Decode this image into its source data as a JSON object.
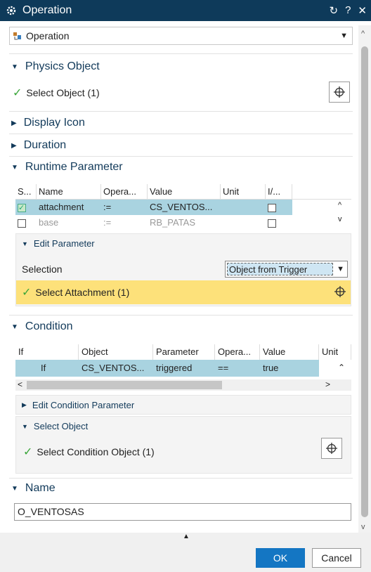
{
  "window": {
    "title": "Operation",
    "controls": [
      "↻",
      "?",
      "✕"
    ]
  },
  "type_dropdown": {
    "value": "Operation"
  },
  "physics_object": {
    "heading": "Physics Object",
    "select_label": "Select Object (1)"
  },
  "display_icon": {
    "heading": "Display Icon"
  },
  "duration": {
    "heading": "Duration"
  },
  "runtime_parameter": {
    "heading": "Runtime Parameter",
    "columns": [
      "S...",
      "Name",
      "Opera...",
      "Value",
      "Unit",
      "I/..."
    ],
    "rows": [
      {
        "name": "attachment",
        "op": ":=",
        "value": "CS_VENTOS...",
        "unit": "",
        "checked": true,
        "selected": true
      },
      {
        "name": "base",
        "op": ":=",
        "value": "RB_PATAS",
        "unit": "",
        "checked": false,
        "selected": false
      }
    ],
    "edit": {
      "heading": "Edit Parameter",
      "selection_label": "Selection",
      "selection_value": "Object from Trigger",
      "select_attachment": "Select Attachment (1)"
    }
  },
  "condition": {
    "heading": "Condition",
    "columns": [
      "If",
      "Object",
      "Parameter",
      "Opera...",
      "Value",
      "Unit"
    ],
    "rows": [
      {
        "if": "If",
        "object": "CS_VENTOS...",
        "parameter": "triggered",
        "op": "==",
        "value": "true",
        "unit": ""
      }
    ],
    "edit_condition_heading": "Edit Condition Parameter",
    "select_object_heading": "Select Object",
    "select_condition_object": "Select Condition Object (1)"
  },
  "name_section": {
    "heading": "Name",
    "value": "O_VENTOSAS"
  },
  "buttons": {
    "ok": "OK",
    "cancel": "Cancel"
  },
  "colors": {
    "titlebar": "#0e3a5a",
    "selected_row": "#a9d3e0",
    "highlight_row": "#fde17a",
    "ok_button": "#1476c3"
  }
}
